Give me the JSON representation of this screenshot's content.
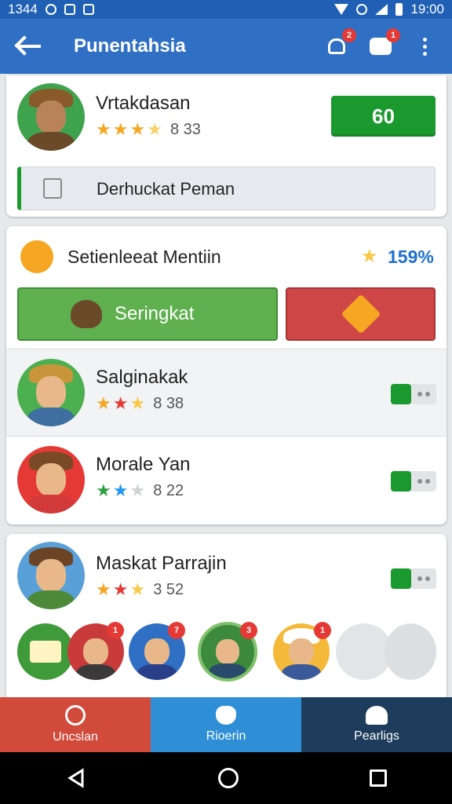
{
  "status_bar": {
    "time_left": "1344",
    "time_right": "19:00"
  },
  "app_bar": {
    "title": "Punentahsia",
    "notification_badge": "2",
    "chat_badge": "1"
  },
  "profile": {
    "name": "Vrtakdasan",
    "rating": "8 33",
    "stars_filled": 3,
    "action_label": "60",
    "field_text": "Derhuckat Pеman"
  },
  "section": {
    "title": "Setienleeat Mentiin",
    "percent": "159%",
    "primary_button": "Seringkat",
    "users": [
      {
        "name": "Salginakak",
        "rating": "8 38",
        "stars": [
          "#f5a623",
          "#e53935",
          "#f7c948"
        ],
        "toggle_on": true
      },
      {
        "name": "Morale Yan",
        "rating": "8 22",
        "stars": [
          "#2ea043",
          "#2196f3",
          "#cfd3d6"
        ],
        "toggle_on": true
      }
    ]
  },
  "card3": {
    "name": "Maskat Parrajin",
    "rating": "3 52",
    "stars": [
      "#f5a623",
      "#e53935",
      "#f7c948"
    ],
    "toggle_on": true,
    "avatar_badges": [
      "1",
      "7",
      "3",
      "1"
    ]
  },
  "tabs": [
    {
      "label": "Uncslan",
      "color": "#d14a3a"
    },
    {
      "label": "Rioerin",
      "color": "#2f8fd6"
    },
    {
      "label": "Pearligs",
      "color": "#1e3d5c"
    }
  ],
  "colors": {
    "primary": "#2f6fc4",
    "green": "#1a9a2e",
    "red": "#d14a3a"
  }
}
